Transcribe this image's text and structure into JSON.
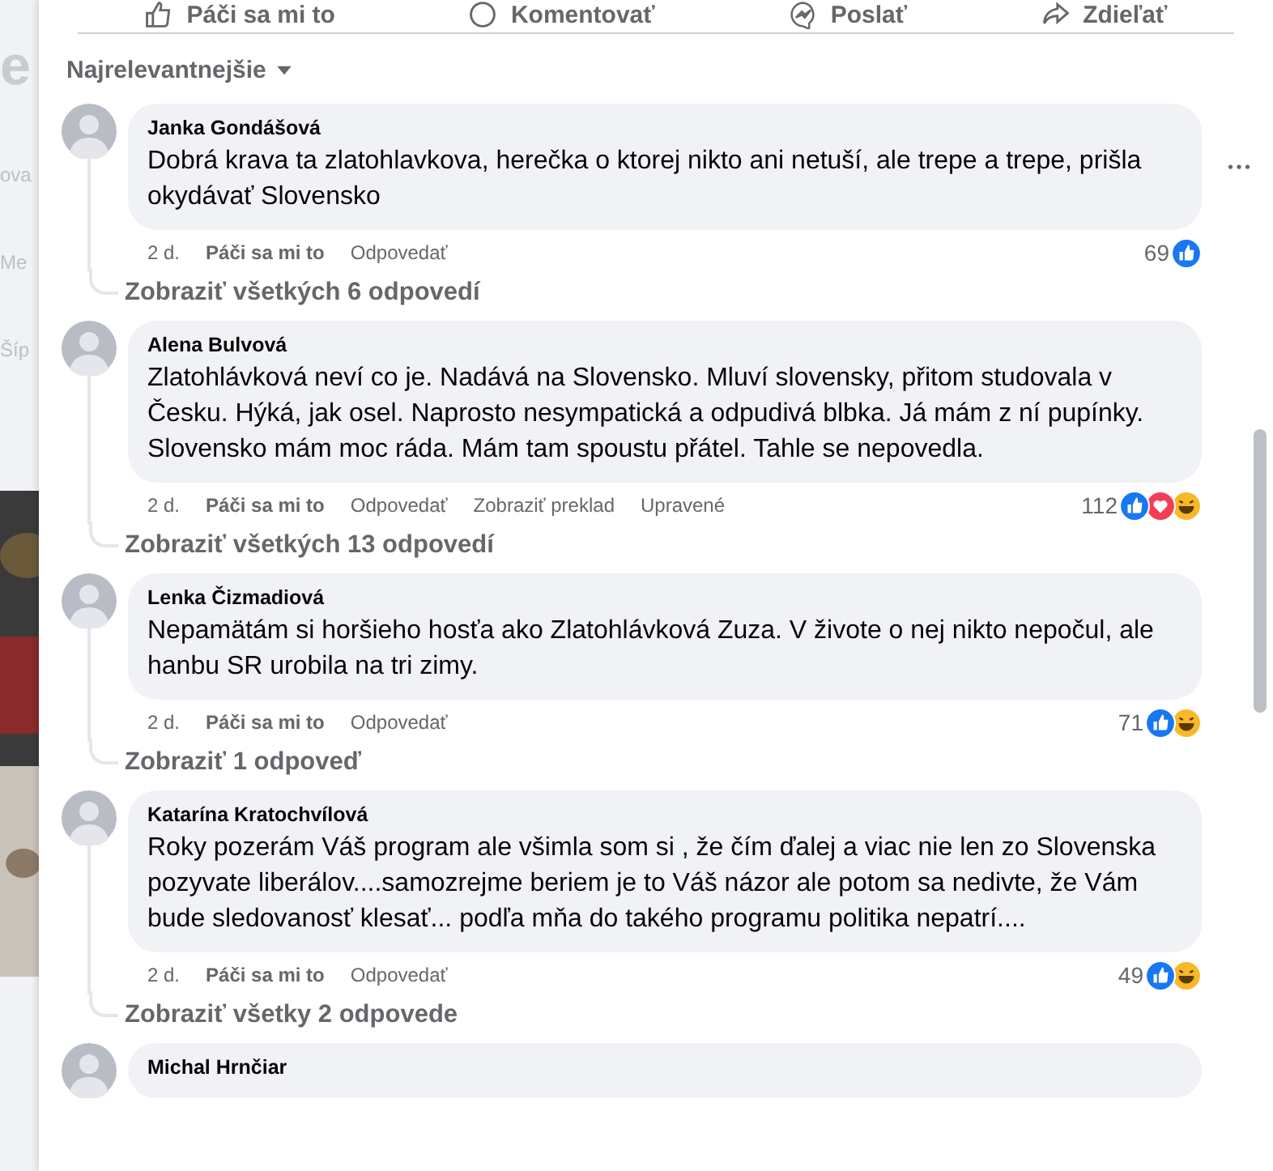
{
  "background_fragments": [
    "e",
    "ova",
    "Me",
    "Šíp"
  ],
  "post_actions": [
    {
      "label": "Páči sa mi to",
      "kind": "like"
    },
    {
      "label": "Komentovať",
      "kind": "comment"
    },
    {
      "label": "Poslať",
      "kind": "send"
    },
    {
      "label": "Zdieľať",
      "kind": "share"
    }
  ],
  "sort": {
    "label": "Najrelevantnejšie"
  },
  "comments": [
    {
      "author": "Janka Gondášová",
      "text": "Dobrá krava ta zlatohlavkova, herečka o ktorej nikto ani netuší, ale trepe a trepe, prišla okydávať Slovensko",
      "time": "2 d.",
      "actions": [
        "Páči sa mi to",
        "Odpovedať"
      ],
      "reaction_count": "69",
      "reactions": [
        {
          "kind": "like"
        }
      ],
      "more_menu": true,
      "replies_link": "Zobraziť všetkých 6 odpovedí"
    },
    {
      "author": "Alena Bulvová",
      "text": "Zlatohlávková neví co je. Nadává na Slovensko. Mluví slovensky, přitom studovala v Česku. Hýká, jak osel. Naprosto nesympatická a odpudivá blbka. Já mám z ní pupínky. Slovensko mám moc ráda. Mám tam spoustu přátel. Tahle se nepovedla.",
      "time": "2 d.",
      "actions": [
        "Páči sa mi to",
        "Odpovedať",
        "Zobraziť preklad",
        "Upravené"
      ],
      "reaction_count": "112",
      "reactions": [
        {
          "kind": "like"
        },
        {
          "kind": "love"
        },
        {
          "kind": "haha"
        }
      ],
      "more_menu": false,
      "replies_link": "Zobraziť všetkých 13 odpovedí"
    },
    {
      "author": "Lenka Čizmadiová",
      "text": "Nepamätám si horšieho hosťa ako Zlatohlávková Zuza. V živote o nej nikto nepočul, ale hanbu SR urobila na tri zimy.",
      "time": "2 d.",
      "actions": [
        "Páči sa mi to",
        "Odpovedať"
      ],
      "reaction_count": "71",
      "reactions": [
        {
          "kind": "like"
        },
        {
          "kind": "haha"
        }
      ],
      "more_menu": false,
      "replies_link": "Zobraziť 1 odpoveď"
    },
    {
      "author": "Katarína Kratochvílová",
      "text": "Roky pozerám Váš program ale všimla som si , že čím ďalej a viac nie len zo Slovenska pozyvate liberálov....samozrejme beriem je to Váš názor ale potom sa nedivte, že Vám bude sledovanosť klesať... podľa mňa do takého programu politika nepatrí....",
      "time": "2 d.",
      "actions": [
        "Páči sa mi to",
        "Odpovedať"
      ],
      "reaction_count": "49",
      "reactions": [
        {
          "kind": "like"
        },
        {
          "kind": "haha"
        }
      ],
      "more_menu": false,
      "replies_link": "Zobraziť všetky 2 odpovede"
    },
    {
      "author": "Michal Hrnčiar",
      "more_menu": false
    }
  ]
}
